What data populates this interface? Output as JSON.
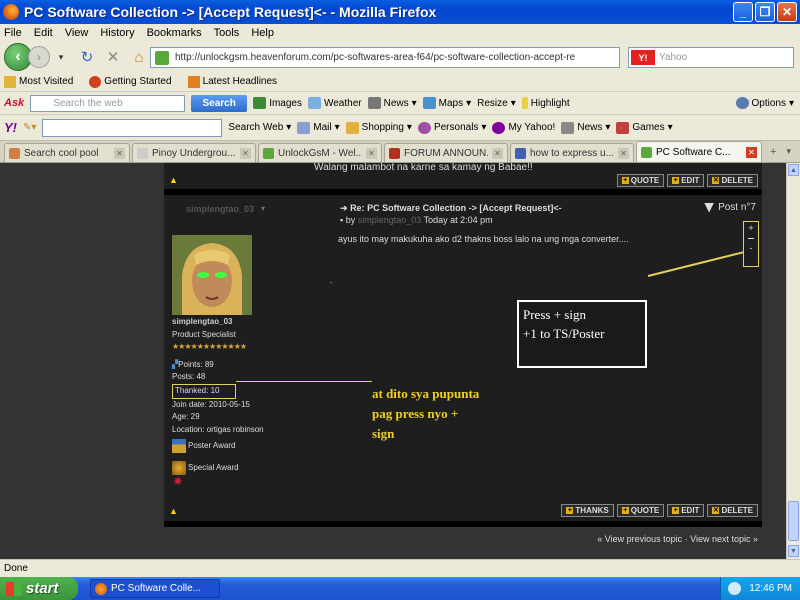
{
  "window": {
    "title": "PC Software Collection -> [Accept Request]<- - Mozilla Firefox"
  },
  "menu": [
    "File",
    "Edit",
    "View",
    "History",
    "Bookmarks",
    "Tools",
    "Help"
  ],
  "navbar": {
    "url": "http://unlockgsm.heavenforum.com/pc-softwares-area-f64/pc-software-collection-accept-re",
    "search_placeholder": "Yahoo"
  },
  "bookmarks": [
    "Most Visited",
    "Getting Started",
    "Latest Headlines"
  ],
  "ask_toolbar": {
    "search_placeholder": "Search the web",
    "search_button": "Search",
    "items": [
      "Images",
      "Weather",
      "News",
      "Maps",
      "Resize",
      "Highlight",
      "Options"
    ]
  },
  "yahoo_toolbar": {
    "items": [
      "Search Web",
      "Mail",
      "Shopping",
      "Personals",
      "My Yahoo!",
      "News",
      "Games"
    ]
  },
  "tabs": [
    {
      "label": "Search cool pool",
      "active": false
    },
    {
      "label": "Pinoy Undergrou...",
      "active": false
    },
    {
      "label": "UnlockGsM - Wel...",
      "active": false
    },
    {
      "label": "FORUM ANNOUN...",
      "active": false
    },
    {
      "label": "how to express u...",
      "active": false
    },
    {
      "label": "PC Software C...",
      "active": true
    }
  ],
  "forum": {
    "prev_post_text": "Walang malambot na karne sa kamay ng Babae!!",
    "buttons_top": [
      "QUOTE",
      "EDIT",
      "DELETE"
    ],
    "buttons_bottom": [
      "THANKS",
      "QUOTE",
      "EDIT",
      "DELETE"
    ],
    "post": {
      "username": "simplengtao_03",
      "title": "Re: PC Software Collection -> [Accept Request]<-",
      "by_prefix": "by",
      "author": "simplengtao_03",
      "time": "Today at 2:04 pm",
      "post_number": "Post n°7",
      "body": "ayus ito may makukuha ako d2 thakns boss lalo na ung mga converter....",
      "vote_plus": "+",
      "vote_minus": "-"
    },
    "user": {
      "name": "simplengtao_03",
      "rank": "Product Specialist",
      "stars": "★★★★★★★★★★★★",
      "points": "Points: 89",
      "posts": "Posts: 48",
      "thanked": "Thanked: 10",
      "join_date": "Join date: 2010-05-15",
      "age": "Age: 29",
      "location": "Location: ortigas robinson",
      "award1": "Poster Award",
      "award2": "Special Award"
    },
    "annotation_box": {
      "line1": "Press + sign",
      "line2": "+1 to TS/Poster"
    },
    "annotation_text": {
      "line1": "at dito sya pupunta",
      "line2": "pag press nyo +",
      "line3": "sign"
    },
    "footer_nav": "« View previous topic · View next topic »"
  },
  "status": "Done",
  "taskbar": {
    "start": "start",
    "item": "PC Software Colle...",
    "clock": "12:46 PM"
  },
  "colors": {
    "titlebar": "#0a5fe0",
    "forum_bg": "#1e1e1e",
    "annotation_yellow": "#f0d020"
  }
}
